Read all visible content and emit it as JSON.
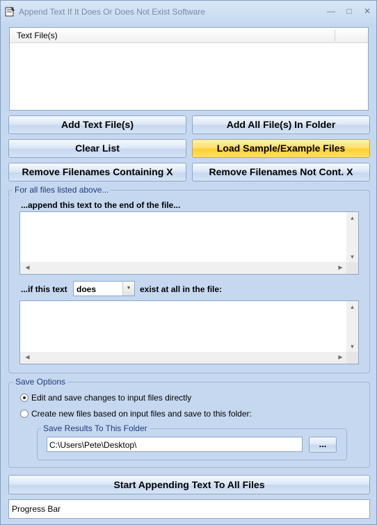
{
  "window": {
    "title": "Append Text If It Does Or Does Not Exist Software",
    "minimize_glyph": "—",
    "maximize_glyph": "□",
    "close_glyph": "✕"
  },
  "file_list": {
    "column_header": "Text File(s)"
  },
  "buttons": {
    "add_text_files": "Add Text File(s)",
    "add_all_in_folder": "Add All File(s) In Folder",
    "clear_list": "Clear List",
    "load_sample": "Load Sample/Example Files",
    "remove_containing": "Remove Filenames Containing X",
    "remove_not_containing": "Remove Filenames Not Cont. X",
    "browse": "...",
    "start": "Start Appending Text To All Files"
  },
  "all_files_group": {
    "label": "For all files listed above...",
    "append_label": "...append this text to the end of the file...",
    "if_text_label": "...if this text",
    "condition_value": "does",
    "exist_label": "exist at all in the file:"
  },
  "save_options": {
    "label": "Save Options",
    "option_edit": "Edit and save changes to input files directly",
    "option_create": "Create new files based on input files and save to this folder:",
    "selected": "edit",
    "folder_group_label": "Save Results To This Folder",
    "folder_value": "C:\\Users\\Pete\\Desktop\\"
  },
  "progress": {
    "label": "Progress Bar"
  },
  "icons": {
    "app": "app-icon",
    "scroll_up": "▲",
    "scroll_down": "▼",
    "scroll_left": "◀",
    "scroll_right": "▶",
    "dropdown": "▼"
  }
}
